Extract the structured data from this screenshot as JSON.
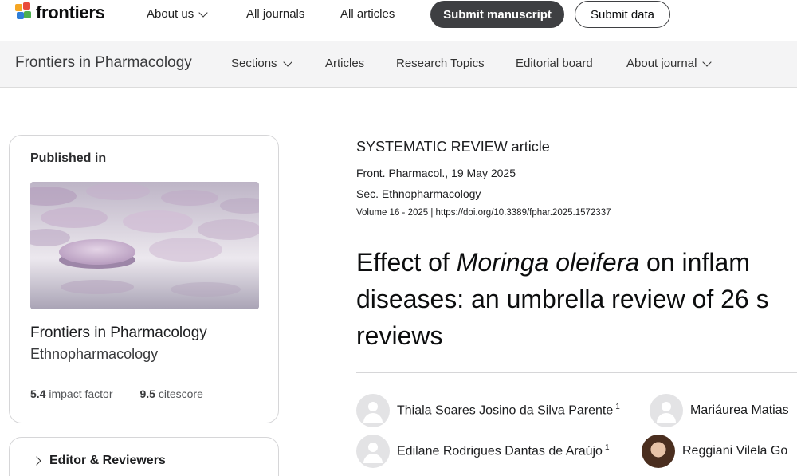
{
  "topnav": {
    "brand": "frontiers",
    "items": [
      "About us",
      "All journals",
      "All articles"
    ],
    "submit_manuscript": "Submit manuscript",
    "submit_data": "Submit data"
  },
  "journalbar": {
    "journal": "Frontiers in Pharmacology",
    "items": [
      "Sections",
      "Articles",
      "Research Topics",
      "Editorial board",
      "About journal"
    ]
  },
  "published": {
    "heading": "Published in",
    "journal": "Frontiers in Pharmacology",
    "section": "Ethnopharmacology",
    "impact_value": "5.4",
    "impact_label": "impact factor",
    "citescore_value": "9.5",
    "citescore_label": "citescore"
  },
  "editor_reviewers": "Editor & Reviewers",
  "article": {
    "type": "SYSTEMATIC REVIEW article",
    "journal_date": "Front. Pharmacol., 19 May 2025",
    "section": "Sec. Ethnopharmacology",
    "volume_doi": "Volume 16 - 2025 | https://doi.org/10.3389/fphar.2025.1572337",
    "title_pre": "Effect of ",
    "title_italic": "Moringa oleifera",
    "title_line1_post": " on inflam",
    "title_line2": "diseases: an umbrella review of 26 s",
    "title_line3": "reviews"
  },
  "authors": [
    {
      "name": "Thiala Soares Josino da Silva Parente",
      "sup": "1"
    },
    {
      "name": "Mariáurea Matias",
      "sup": ""
    },
    {
      "name": "Edilane Rodrigues Dantas de Araújo",
      "sup": "1"
    },
    {
      "name": "Reggiani Vilela Go",
      "sup": ""
    }
  ]
}
